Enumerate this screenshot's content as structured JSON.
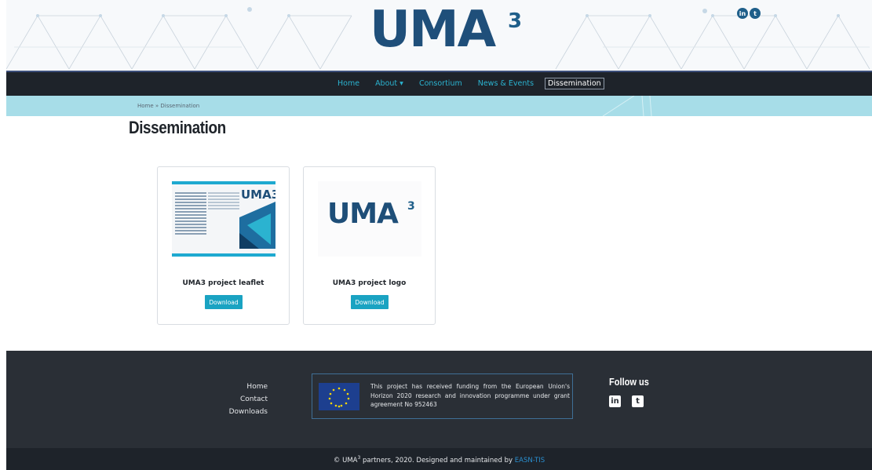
{
  "header": {
    "logo_text": "UMA",
    "logo_superscript": "3",
    "social": [
      {
        "icon": "linkedin-icon",
        "glyph": "in"
      },
      {
        "icon": "twitter-icon",
        "glyph": "t"
      }
    ]
  },
  "nav": {
    "items": [
      {
        "label": "Home"
      },
      {
        "label": "About ▾"
      },
      {
        "label": "Consortium"
      },
      {
        "label": "News & Events"
      },
      {
        "label": "Dissemination"
      }
    ],
    "active_index": 4
  },
  "breadcrumb": {
    "text": "Home » Dissemination"
  },
  "page": {
    "title": "Dissemination"
  },
  "cards": [
    {
      "title": "UMA3 project leaflet",
      "button": "Download",
      "thumb_logo": "UMA3"
    },
    {
      "title": "UMA3 project logo",
      "button": "Download"
    }
  ],
  "footer": {
    "links": [
      "Home",
      "Contact",
      "Downloads"
    ],
    "funding_text": "This project has received funding from the European Union's Horizon 2020 research and innovation programme under grant agreement No 952463",
    "follow_label": "Follow us",
    "social_glyphs": {
      "linkedin": "in",
      "twitter": "t"
    }
  },
  "copyright": {
    "prefix": "© UMA",
    "sup": "3",
    "middle": " partners, 2020. Designed and maintained by ",
    "link": "EASN-TIS"
  },
  "colors": {
    "accent": "#1aa3c2",
    "nav_bg": "#1e232a",
    "breadcrumb_bg": "#a7dde8",
    "footer_bg": "#2a2f36"
  }
}
